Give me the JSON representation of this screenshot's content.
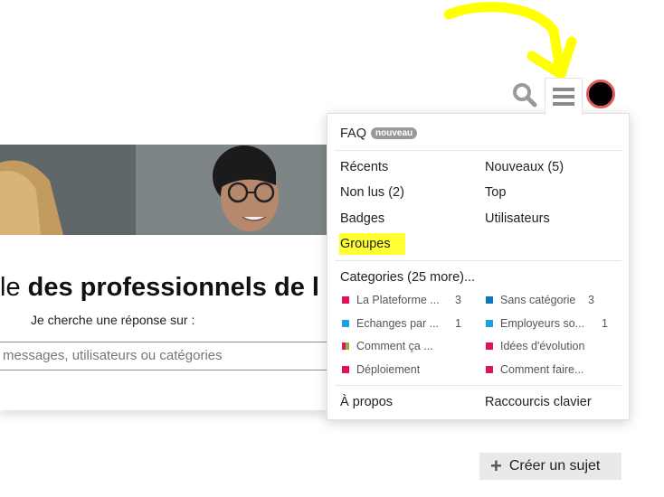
{
  "header": {
    "search_icon": "search-icon",
    "menu_icon": "hamburger-menu-icon",
    "avatar_color": "#000000",
    "avatar_ring": "#e45765"
  },
  "welcome": {
    "title_prefix": "le ",
    "title_bold": "des professionnels de l",
    "search_hint": "Je cherche une réponse sur :",
    "search_placeholder": "messages, utilisateurs ou catégories"
  },
  "menu": {
    "faq": "FAQ",
    "faq_badge": "nouveau",
    "links": {
      "recent": "Récents",
      "new": "Nouveaux (5)",
      "unread": "Non lus (2)",
      "top": "Top",
      "badges": "Badges",
      "users": "Utilisateurs",
      "groups": "Groupes"
    },
    "categories_title": "Categories (25 more)...",
    "categories": [
      {
        "name": "La Plateforme ...",
        "count": "3",
        "color": "#e0115f"
      },
      {
        "name": "Sans catégorie",
        "count": "3",
        "color": "#0e76bd"
      },
      {
        "name": "Echanges par ...",
        "count": "1",
        "color": "#1ba1e2"
      },
      {
        "name": "Employeurs so...",
        "count": "1",
        "color": "#1ba1e2"
      },
      {
        "name": "Comment ça ...",
        "count": "",
        "color": "#8fb03a"
      },
      {
        "name": "Idées d'évolution",
        "count": "",
        "color": "#e0115f"
      },
      {
        "name": "Déploiement",
        "count": "",
        "color": "#e0115f"
      },
      {
        "name": "Comment faire...",
        "count": "",
        "color": "#e0115f"
      }
    ],
    "about": "À propos",
    "shortcuts": "Raccourcis clavier"
  },
  "create_topic": {
    "label": "Créer un sujet"
  },
  "colors": {
    "highlight": "#ffff33",
    "annotation": "#ffff00"
  }
}
